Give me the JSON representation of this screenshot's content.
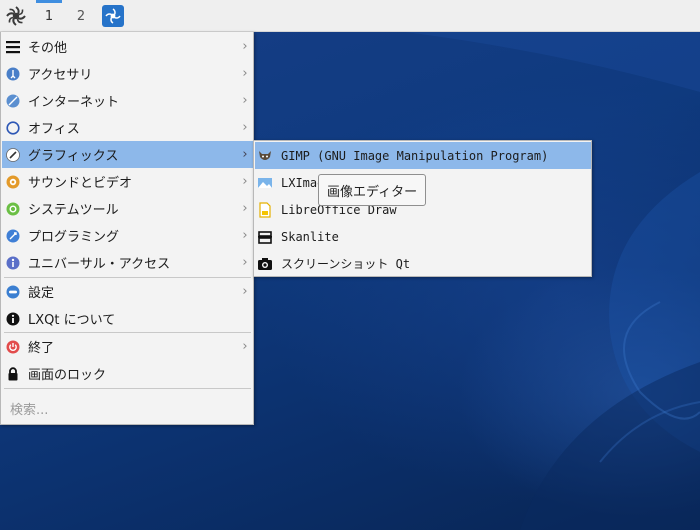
{
  "panel": {
    "start_icon": "lxqt-logo-icon",
    "workspaces": [
      {
        "label": "1",
        "active": true
      },
      {
        "label": "2",
        "active": false
      }
    ],
    "task_icon": "screenshot-app-icon",
    "accent_color": "#3f8ee0"
  },
  "menu": {
    "items": [
      {
        "label": "その他",
        "icon": "menu-lines-icon",
        "has_submenu": true
      },
      {
        "label": "アクセサリ",
        "icon": "accessories-icon",
        "has_submenu": true
      },
      {
        "label": "インターネット",
        "icon": "internet-icon",
        "has_submenu": true
      },
      {
        "label": "オフィス",
        "icon": "office-icon",
        "has_submenu": true
      },
      {
        "label": "グラフィックス",
        "icon": "graphics-icon",
        "has_submenu": true,
        "active": true
      },
      {
        "label": "サウンドとビデオ",
        "icon": "multimedia-icon",
        "has_submenu": true
      },
      {
        "label": "システムツール",
        "icon": "system-tools-icon",
        "has_submenu": true
      },
      {
        "label": "プログラミング",
        "icon": "development-icon",
        "has_submenu": true
      },
      {
        "label": "ユニバーサル・アクセス",
        "icon": "accessibility-icon",
        "has_submenu": true
      },
      {
        "label": "設定",
        "icon": "settings-icon",
        "has_submenu": true
      },
      {
        "label": "LXQt について",
        "icon": "info-icon",
        "has_submenu": false
      },
      {
        "label": "終了",
        "icon": "power-icon",
        "has_submenu": true
      },
      {
        "label": "画面のロック",
        "icon": "lock-icon",
        "has_submenu": false
      }
    ],
    "search_placeholder": "検索...",
    "highlight_color": "#8db8ea"
  },
  "submenu": {
    "items": [
      {
        "label": "GIMP (GNU Image Manipulation Program)",
        "icon": "gimp-icon",
        "active": true
      },
      {
        "label": "LXImage",
        "icon": "image-viewer-icon"
      },
      {
        "label": "LibreOffice Draw",
        "icon": "libreoffice-draw-icon"
      },
      {
        "label": "Skanlite",
        "icon": "scanner-icon"
      },
      {
        "label": "スクリーンショット Qt",
        "icon": "camera-icon"
      }
    ]
  },
  "tooltip": {
    "text": "画像エディター"
  }
}
